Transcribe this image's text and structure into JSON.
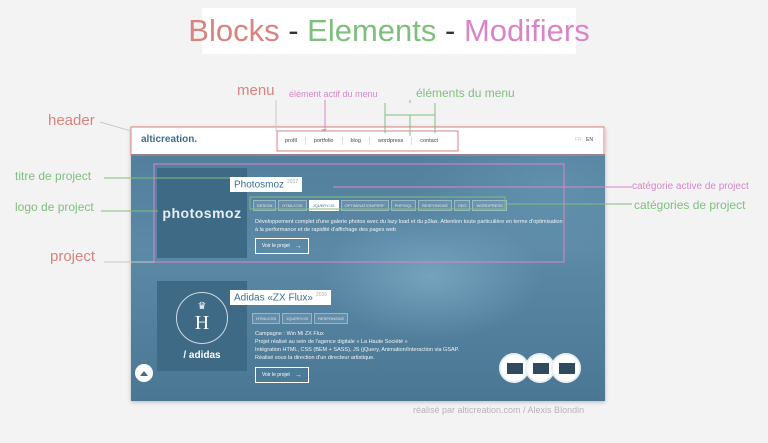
{
  "title": {
    "blocks": "Blocks",
    "sep1": " - ",
    "elements": "Elements",
    "sep2": " - ",
    "modifiers": "Modifiers"
  },
  "annotations": {
    "menu": "menu",
    "active_element": "élément actif du menu",
    "menu_elements": "éléments du menu",
    "header": "header",
    "project_title": "titre de project",
    "project_logo": "logo de project",
    "project": "project",
    "active_category": "catégorie active de project",
    "project_categories": "catégories de project"
  },
  "site": {
    "logo": "alticreation.",
    "nav": [
      "profil",
      "portfolio",
      "blog",
      "wordpress",
      "contact"
    ],
    "lang": {
      "fr": "FR",
      "en": "EN"
    },
    "projects": [
      {
        "logo_text": "photosmoz",
        "title": "Photosmoz",
        "year": "2017",
        "categories": [
          "DESIGN",
          "HTML/CSS",
          "JQUERY/JS",
          "OPTIMISATION/PERF",
          "PHP/SQL",
          "RESPONSIVE",
          "SEO",
          "WORDPRESS"
        ],
        "active_category": "JQUERY/JS",
        "description": "Développement complet d'une galerie photos avec du lazy load et du p3lax. Attention toute particulière en terme d'optimisation à la performance et de rapidité d'affichage des pages web",
        "button": "Voir le projet"
      },
      {
        "logo_text": "/ adidas",
        "logo_crest": "H",
        "title": "Adidas «ZX Flux»",
        "year": "2016",
        "categories": [
          "HTML/CSS",
          "JQUERY/JS",
          "RESPONSIVE"
        ],
        "description_lines": [
          "Campagne : Win Mi ZX Flux",
          "Projet réalisé au sein de l'agence digitale « La Haute Société »",
          "Intégration HTML, CSS (BEM + SASS), JS (jQuery, Animation/Interaction via GSAP.",
          "Réalisé sous la direction d'un directeur artistique."
        ],
        "button": "Voir le projet"
      }
    ]
  },
  "credit": "réalisé par alticreation.com / Alexis Blondin",
  "colors": {
    "blocks": "#d9827e",
    "elements": "#7fbf7d",
    "modifiers": "#d886c8",
    "site_bg": "#4f7c98"
  }
}
